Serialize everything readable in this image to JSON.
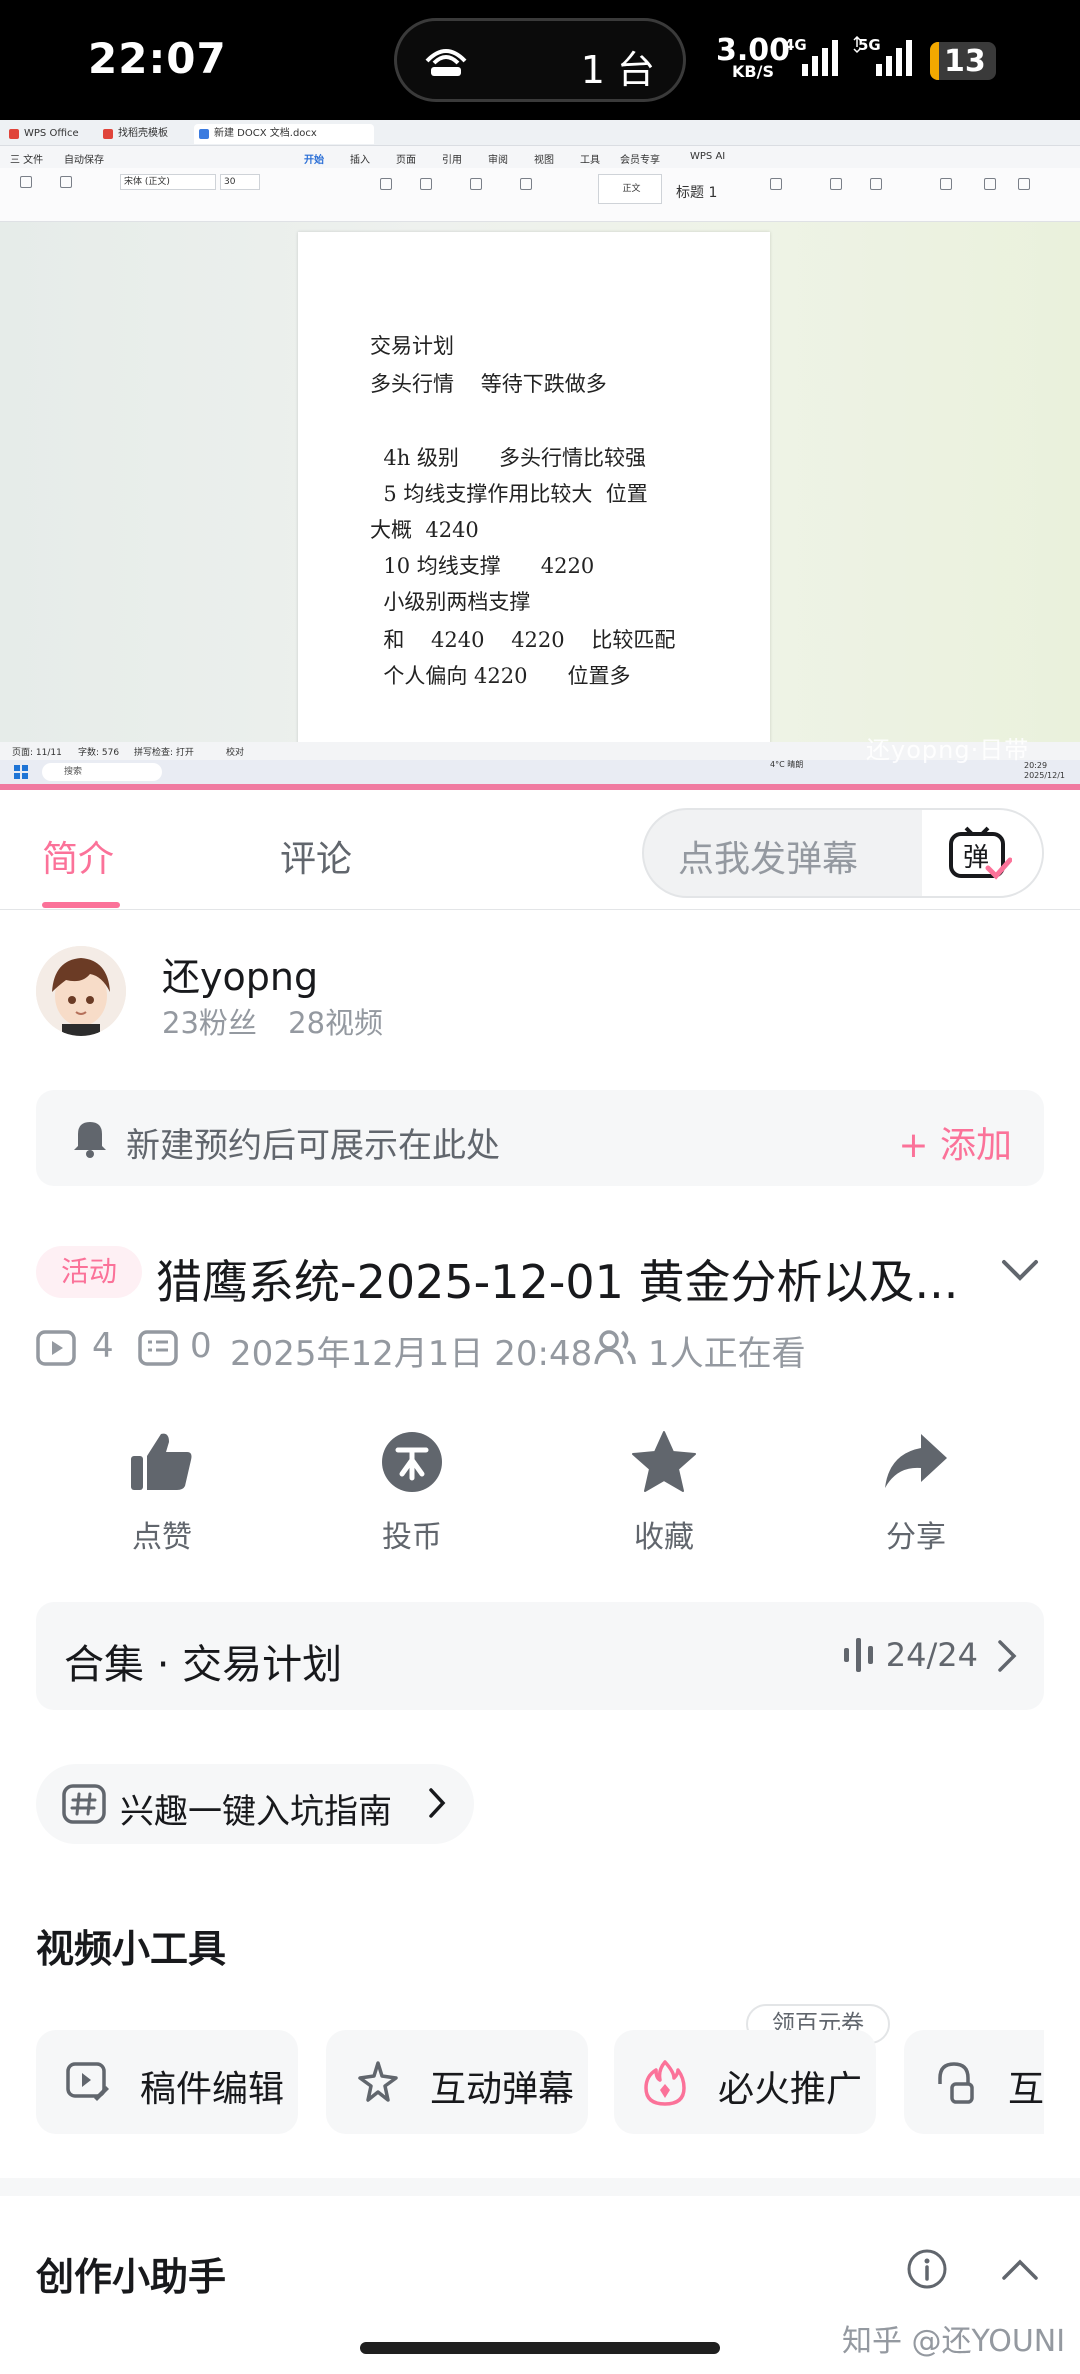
{
  "status_bar": {
    "time": "22:07",
    "hotspot_count": "1 台",
    "speed_value": "3.00",
    "speed_unit": "KB/S",
    "net1": "4G",
    "net2": "5G",
    "battery": "13",
    "battery_level": 0.13
  },
  "video": {
    "wps": {
      "tabs": [
        "WPS Office",
        "找稻壳模板",
        "新建 DOCX 文档.docx"
      ],
      "menu": [
        "三 文件",
        "自动保存",
        "开始",
        "插入",
        "页面",
        "引用",
        "审阅",
        "视图",
        "工具",
        "会员专享",
        "WPS AI"
      ],
      "font_name": "宋体 (正文)",
      "font_size": "30",
      "style_normal": "正文",
      "style_heading": "标题 1",
      "status_left": "页面: 11/11",
      "status_words": "字数: 576",
      "status_spell": "拼写检查: 打开",
      "status_proof": "校对",
      "taskbar_search": "搜索",
      "weather": "4°C 晴朗",
      "clock_time": "20:29",
      "clock_date": "2025/12/1"
    },
    "doc_lines": [
      "交易计划",
      "多头行情    等待下跌做多",
      "",
      "  4h 级别      多头行情比较强",
      "  5 均线支撑作用比较大  位置",
      "大概  4240",
      "  10 均线支撑      4220",
      "  小级别两档支撑",
      "  和    4240    4220    比较匹配",
      "  个人偏向 4220      位置多"
    ],
    "overlay": "还yopng·日带"
  },
  "tabs": {
    "intro": "简介",
    "comments": "评论",
    "danmaku_placeholder": "点我发弹幕",
    "danmaku_btn": "弹"
  },
  "uploader": {
    "name": "还yopng",
    "fans": "23粉丝",
    "videos": "28视频"
  },
  "reservation": {
    "text": "新建预约后可展示在此处",
    "add": "+ 添加"
  },
  "video_info": {
    "badge": "活动",
    "title": "猎鹰系统-2025-12-01 黄金分析以及...",
    "plays": "4",
    "danmaku": "0",
    "date": "2025年12月1日 20:48",
    "watching": "1人正在看"
  },
  "actions": [
    {
      "label": "点赞",
      "icon": "thumb-up-icon"
    },
    {
      "label": "投币",
      "icon": "coin-icon"
    },
    {
      "label": "收藏",
      "icon": "star-icon"
    },
    {
      "label": "分享",
      "icon": "share-icon"
    }
  ],
  "collection": {
    "title": "合集 · 交易计划",
    "count": "24/24"
  },
  "interest": {
    "label": "兴趣一键入坑指南"
  },
  "tools": {
    "heading": "视频小工具",
    "items": [
      "稿件编辑",
      "互动弹幕",
      "必火推广",
      "互动"
    ],
    "promo": "领百元券"
  },
  "assistant": {
    "heading": "创作小助手"
  },
  "watermark": "知乎 @还YOUNI",
  "colors": {
    "accent": "#fb7299",
    "text_secondary": "#9499a0"
  }
}
